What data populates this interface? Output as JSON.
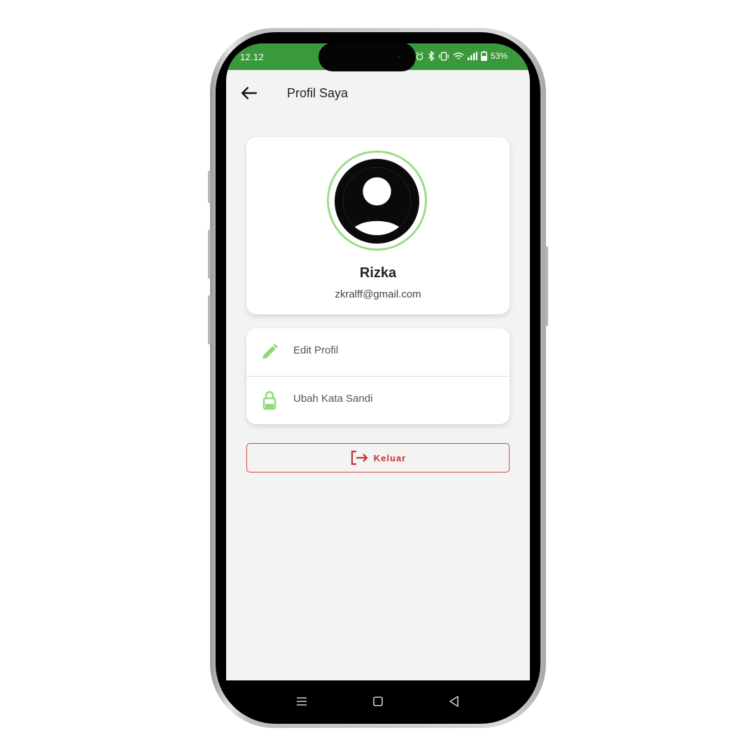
{
  "status_bar": {
    "time": "12.12",
    "battery": "53%",
    "icons": [
      "alarm-icon",
      "bluetooth-icon",
      "vibrate-icon",
      "wifi-icon",
      "signal-icon",
      "battery-icon"
    ]
  },
  "app_bar": {
    "title": "Profil Saya",
    "back_icon": "arrow-left-icon"
  },
  "profile": {
    "name": "Rizka",
    "email": "zkralff@gmail.com",
    "avatar_icon": "account-circle-icon"
  },
  "menu": {
    "items": [
      {
        "label": "Edit Profil",
        "icon": "pencil-icon"
      },
      {
        "label": "Ubah Kata Sandi",
        "icon": "lock-icon"
      }
    ]
  },
  "logout": {
    "label": "Keluar",
    "icon": "logout-icon"
  },
  "navigation": {
    "buttons": [
      "menu-icon",
      "home-square-icon",
      "back-triangle-icon"
    ]
  },
  "colors": {
    "status_bar": "#3a9a3b",
    "accent_green": "#8fd97a",
    "logout_red": "#c8302e",
    "background": "#f3f3f3"
  }
}
